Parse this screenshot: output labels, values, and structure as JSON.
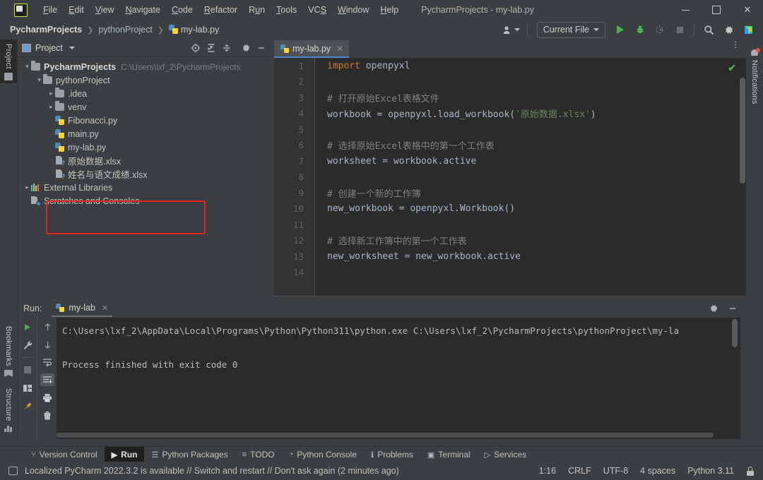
{
  "window": {
    "title": "PycharmProjects - my-lab.py",
    "logo_icon": "pycharm-logo-icon",
    "minimize_icon": "minimize-icon",
    "maximize_icon": "maximize-icon",
    "close_icon": "close-icon"
  },
  "menu": [
    {
      "label": "File",
      "mnemonic": "F"
    },
    {
      "label": "Edit",
      "mnemonic": "E"
    },
    {
      "label": "View",
      "mnemonic": "V"
    },
    {
      "label": "Navigate",
      "mnemonic": "N"
    },
    {
      "label": "Code",
      "mnemonic": "C"
    },
    {
      "label": "Refactor",
      "mnemonic": "R"
    },
    {
      "label": "Run",
      "mnemonic": "u"
    },
    {
      "label": "Tools",
      "mnemonic": "T"
    },
    {
      "label": "VCS",
      "mnemonic": "S"
    },
    {
      "label": "Window",
      "mnemonic": "W"
    },
    {
      "label": "Help",
      "mnemonic": "H"
    }
  ],
  "breadcrumbs": [
    {
      "label": "PycharmProjects",
      "bold": true
    },
    {
      "label": "pythonProject",
      "bold": false
    },
    {
      "label": "my-lab.py",
      "bold": false,
      "icon": "python-file-icon"
    }
  ],
  "toolbar": {
    "account_icon": "account-icon",
    "run_config": "Current File",
    "run_icon": "run-play-icon",
    "debug_icon": "debug-bug-icon",
    "coverage_icon": "run-coverage-icon",
    "stop_icon": "stop-icon",
    "search_icon": "search-icon",
    "settings_icon": "gear-icon",
    "help_icon": "pycharm-feature-icon"
  },
  "left_strip": [
    {
      "label": "Project",
      "icon": "project-icon",
      "active": true
    },
    {
      "label": "Bookmarks",
      "icon": "bookmark-icon",
      "active": false
    },
    {
      "label": "Structure",
      "icon": "structure-icon",
      "active": false
    }
  ],
  "right_strip": [
    {
      "label": "Notifications",
      "icon": "notifications-bell-icon",
      "active": false
    }
  ],
  "project_panel": {
    "title": "Project",
    "title_icon": "project-window-icon",
    "dropdown_icon": "chevron-down-icon",
    "toolbar_icons": [
      {
        "name": "select-opened-file-icon",
        "glyph": "⊕"
      },
      {
        "name": "expand-all-icon",
        "glyph": "↧"
      },
      {
        "name": "collapse-all-icon",
        "glyph": "⤓"
      },
      {
        "name": "settings-gear-icon",
        "glyph": "⚙"
      },
      {
        "name": "hide-icon",
        "glyph": "—"
      }
    ],
    "tree": [
      {
        "label": "PycharmProjects",
        "path": "C:\\Users\\lxf_2\\PycharmProjects",
        "indent": 0,
        "arrow": "open",
        "icon": "folder-icon",
        "bold": true
      },
      {
        "label": "pythonProject",
        "path": "",
        "indent": 1,
        "arrow": "open",
        "icon": "folder-icon",
        "bold": false
      },
      {
        "label": ".idea",
        "path": "",
        "indent": 2,
        "arrow": "closed",
        "icon": "folder-icon",
        "bold": false
      },
      {
        "label": "venv",
        "path": "",
        "indent": 2,
        "arrow": "closed",
        "icon": "folder-icon",
        "bold": false
      },
      {
        "label": "Fibonacci.py",
        "path": "",
        "indent": 2,
        "arrow": "none",
        "icon": "python-file-icon",
        "bold": false
      },
      {
        "label": "main.py",
        "path": "",
        "indent": 2,
        "arrow": "none",
        "icon": "python-file-icon",
        "bold": false
      },
      {
        "label": "my-lab.py",
        "path": "",
        "indent": 2,
        "arrow": "none",
        "icon": "python-file-icon",
        "bold": false
      },
      {
        "label": "原始数据.xlsx",
        "path": "",
        "indent": 2,
        "arrow": "none",
        "icon": "xlsx-file-icon",
        "bold": false
      },
      {
        "label": "姓名与语文成绩.xlsx",
        "path": "",
        "indent": 2,
        "arrow": "none",
        "icon": "xlsx-file-icon",
        "bold": false
      },
      {
        "label": "External Libraries",
        "path": "",
        "indent": 0,
        "arrow": "closed",
        "icon": "libraries-icon",
        "bold": false
      },
      {
        "label": "Scratches and Consoles",
        "path": "",
        "indent": 0,
        "arrow": "none",
        "icon": "scratches-icon",
        "bold": false
      }
    ],
    "highlight_color": "#e8241e"
  },
  "editor": {
    "tab": {
      "label": "my-lab.py",
      "icon": "python-file-icon",
      "close_icon": "close-icon"
    },
    "options_icon": "more-options-icon",
    "inspection_icon": "inspection-ok-check-icon",
    "lines": [
      {
        "n": "1",
        "tokens": [
          {
            "t": "import",
            "c": "kw"
          },
          {
            "t": " openpyxl",
            "c": ""
          }
        ]
      },
      {
        "n": "2",
        "tokens": []
      },
      {
        "n": "3",
        "tokens": [
          {
            "t": "# 打开原始Excel表格文件",
            "c": "cm"
          }
        ]
      },
      {
        "n": "4",
        "tokens": [
          {
            "t": "workbook = openpyxl.load_workbook(",
            "c": ""
          },
          {
            "t": "'原始数据.xlsx'",
            "c": "st"
          },
          {
            "t": ")",
            "c": ""
          }
        ]
      },
      {
        "n": "5",
        "tokens": []
      },
      {
        "n": "6",
        "tokens": [
          {
            "t": "# 选择原始Excel表格中的第一个工作表",
            "c": "cm"
          }
        ]
      },
      {
        "n": "7",
        "tokens": [
          {
            "t": "worksheet = workbook.active",
            "c": ""
          }
        ]
      },
      {
        "n": "8",
        "tokens": []
      },
      {
        "n": "9",
        "tokens": [
          {
            "t": "# 创建一个新的工作簿",
            "c": "cm"
          }
        ]
      },
      {
        "n": "10",
        "tokens": [
          {
            "t": "new_workbook = openpyxl.Workbook()",
            "c": ""
          }
        ]
      },
      {
        "n": "11",
        "tokens": []
      },
      {
        "n": "12",
        "tokens": [
          {
            "t": "# 选择新工作簿中的第一个工作表",
            "c": "cm"
          }
        ]
      },
      {
        "n": "13",
        "tokens": [
          {
            "t": "new_worksheet = new_workbook.active",
            "c": ""
          }
        ]
      },
      {
        "n": "14",
        "tokens": []
      }
    ]
  },
  "run_panel": {
    "label": "Run:",
    "tab": {
      "label": "my-lab",
      "icon": "python-file-icon",
      "close_icon": "close-icon"
    },
    "settings_icon": "gear-icon",
    "hide_icon": "hide-icon",
    "left_tools": [
      {
        "name": "rerun-icon",
        "glyph": "▶"
      },
      {
        "name": "edit-configuration-wrench-icon",
        "glyph": "ὒ7"
      },
      {
        "name": "stop-icon",
        "glyph": "■"
      },
      {
        "name": "layout-settings-icon",
        "glyph": "▤"
      },
      {
        "name": "pin-tab-icon",
        "glyph": "ὌC"
      }
    ],
    "right_tools": [
      {
        "name": "up-stacktrace-icon",
        "glyph": "↑"
      },
      {
        "name": "down-stacktrace-icon",
        "glyph": "↓"
      },
      {
        "name": "soft-wrap-icon",
        "glyph": "↩"
      },
      {
        "name": "scroll-to-end-icon",
        "glyph": "⇩"
      },
      {
        "name": "print-icon",
        "glyph": "⎙"
      },
      {
        "name": "clear-all-trash-icon",
        "glyph": "Ὕ1"
      }
    ],
    "output": [
      "C:\\Users\\lxf_2\\AppData\\Local\\Programs\\Python\\Python311\\python.exe C:\\Users\\lxf_2\\PycharmProjects\\pythonProject\\my-la",
      "",
      "Process finished with exit code 0"
    ]
  },
  "tool_window_bar": [
    {
      "label": "Version Control",
      "icon": "version-control-icon",
      "active": false
    },
    {
      "label": "Run",
      "icon": "run-play-icon",
      "active": true
    },
    {
      "label": "Python Packages",
      "icon": "packages-icon",
      "active": false
    },
    {
      "label": "TODO",
      "icon": "todo-list-icon",
      "active": false
    },
    {
      "label": "Python Console",
      "icon": "python-console-icon",
      "active": false
    },
    {
      "label": "Problems",
      "icon": "problems-icon",
      "active": false
    },
    {
      "label": "Terminal",
      "icon": "terminal-icon",
      "active": false
    },
    {
      "label": "Services",
      "icon": "services-icon",
      "active": false
    }
  ],
  "status_bar": {
    "message_icon": "notification-doc-icon",
    "message": "Localized PyCharm 2022.3.2 is available // Switch and restart // Don't ask again (2 minutes ago)",
    "caret_position": "1:16",
    "line_separator": "CRLF",
    "encoding": "UTF-8",
    "indent": "4 spaces",
    "interpreter": "Python 3.11",
    "lock_icon": "lock-icon"
  }
}
